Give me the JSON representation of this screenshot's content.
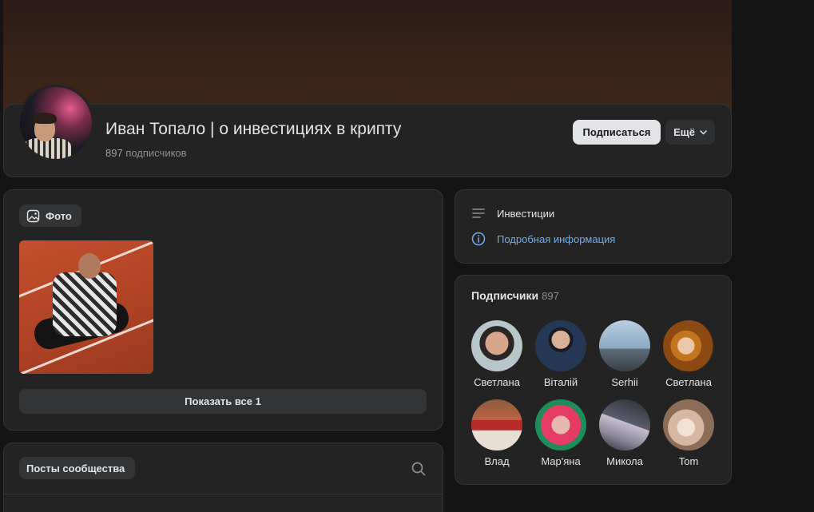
{
  "profile": {
    "name": "Иван Топало | о инвестициях в крипту",
    "subscribers_count": "897",
    "subscribers_label": "подписчиков",
    "subscribe_label": "Подписаться",
    "more_label": "Ещё"
  },
  "photos": {
    "chip_label": "Фото",
    "show_all_label": "Показать все 1"
  },
  "posts": {
    "chip_label": "Посты сообщества"
  },
  "info": {
    "category": "Инвестиции",
    "details_link": "Подробная информация"
  },
  "subscribers": {
    "title": "Подписчики",
    "count": "897",
    "members": [
      {
        "name": "Светлана"
      },
      {
        "name": "Віталій"
      },
      {
        "name": "Serhii"
      },
      {
        "name": "Светлана"
      },
      {
        "name": "Влад"
      },
      {
        "name": "Мар'яна"
      },
      {
        "name": "Микола"
      },
      {
        "name": "Tom"
      }
    ]
  },
  "colors": {
    "background": "#141414",
    "card": "#232323",
    "link": "#71aaeb",
    "primary_button": "#e1e3e6"
  }
}
